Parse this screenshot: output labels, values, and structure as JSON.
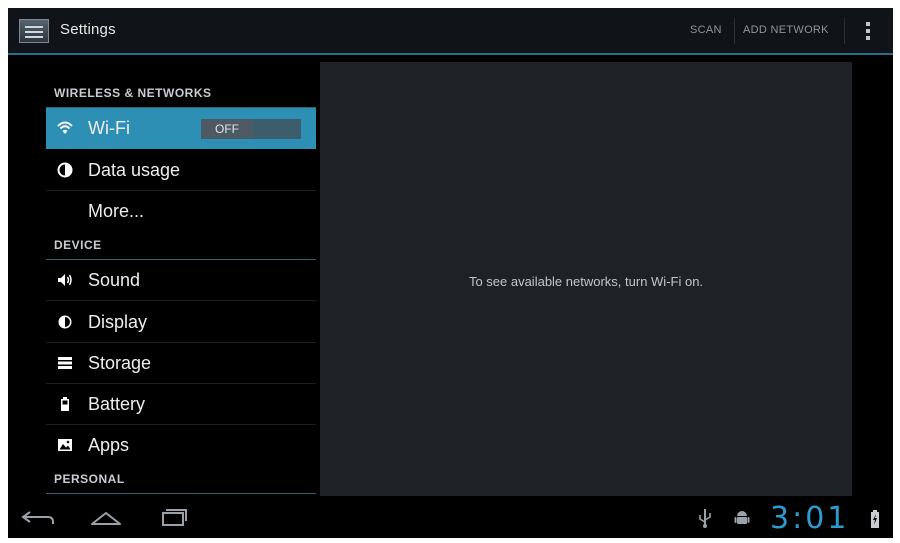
{
  "action_bar": {
    "title": "Settings",
    "actions": [
      "SCAN",
      "ADD NETWORK"
    ]
  },
  "sidebar": {
    "sections": [
      {
        "header": "WIRELESS & NETWORKS"
      },
      {
        "header": "DEVICE"
      },
      {
        "header": "PERSONAL"
      }
    ],
    "items": [
      {
        "label": "Wi-Fi",
        "icon": "wifi-icon",
        "toggle": "OFF",
        "selected": true
      },
      {
        "label": "Data usage",
        "icon": "data-usage-icon"
      },
      {
        "label": "More...",
        "icon": ""
      },
      {
        "label": "Sound",
        "icon": "speaker-icon"
      },
      {
        "label": "Display",
        "icon": "brightness-icon"
      },
      {
        "label": "Storage",
        "icon": "storage-icon"
      },
      {
        "label": "Battery",
        "icon": "battery-icon"
      },
      {
        "label": "Apps",
        "icon": "apps-icon"
      }
    ]
  },
  "detail": {
    "message": "To see available networks, turn Wi-Fi on."
  },
  "status_bar": {
    "time": "3:01"
  },
  "colors": {
    "accent": "#2d8fb4",
    "clock": "#2e9bd0",
    "panel": "#1f2225"
  }
}
